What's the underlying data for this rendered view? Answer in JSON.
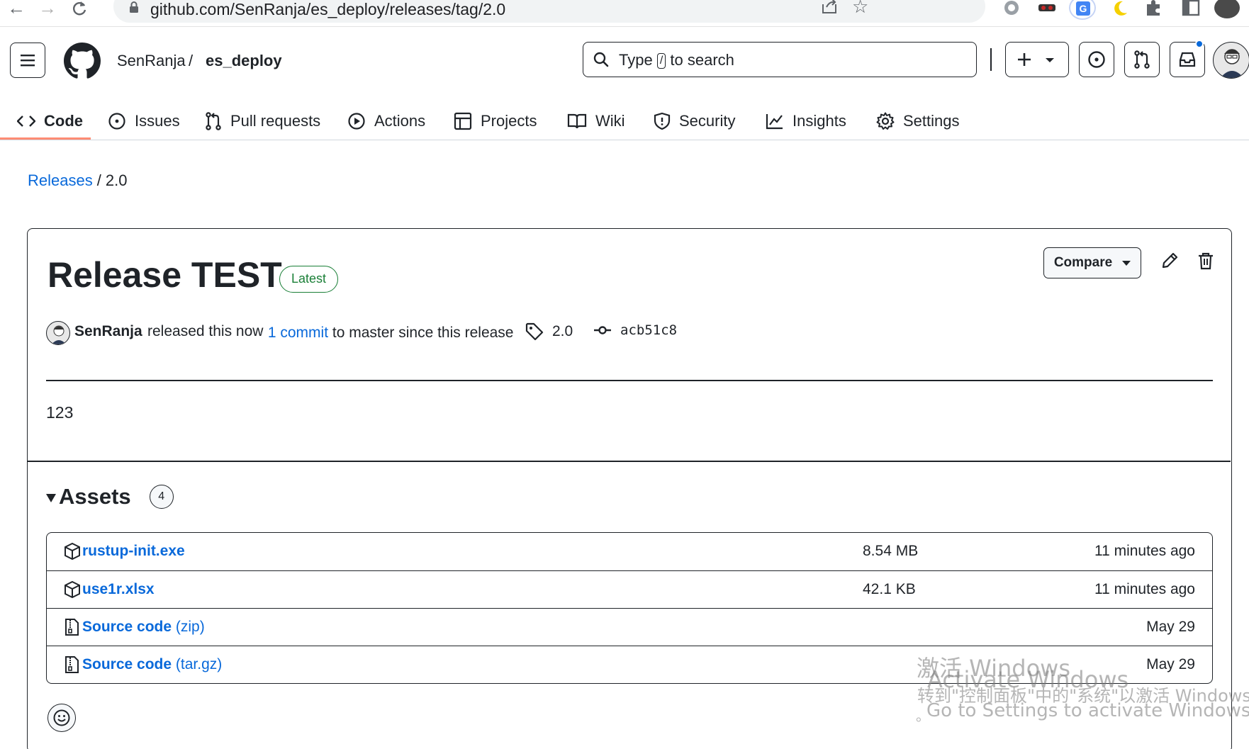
{
  "browser": {
    "url": "github.com/SenRanja/es_deploy/releases/tag/2.0"
  },
  "header": {
    "owner": "SenRanja",
    "separator": "/",
    "repo": "es_deploy",
    "search": {
      "prefix": "Type",
      "key": "/",
      "suffix": "to search"
    }
  },
  "tabs": [
    {
      "label": "Code",
      "icon": "code-icon",
      "active": true
    },
    {
      "label": "Issues",
      "icon": "issue-opened-icon"
    },
    {
      "label": "Pull requests",
      "icon": "git-pull-request-icon"
    },
    {
      "label": "Actions",
      "icon": "play-icon"
    },
    {
      "label": "Projects",
      "icon": "table-icon"
    },
    {
      "label": "Wiki",
      "icon": "book-icon"
    },
    {
      "label": "Security",
      "icon": "shield-icon"
    },
    {
      "label": "Insights",
      "icon": "graph-icon"
    },
    {
      "label": "Settings",
      "icon": "gear-icon"
    }
  ],
  "breadcrumb": {
    "link": "Releases",
    "separator": "/",
    "current": "2.0"
  },
  "release": {
    "title": "Release TEST",
    "badge": "Latest",
    "compare_label": "Compare",
    "author": "SenRanja",
    "released_text": "released this now",
    "commit_prefix": "·",
    "commit_link": "1 commit",
    "commit_suffix": "to master since this release",
    "tag": "2.0",
    "sha": "acb51c8",
    "body": "123"
  },
  "assets": {
    "title": "Assets",
    "count": "4",
    "items": [
      {
        "name": "rustup-init.exe",
        "extra": "",
        "size": "8.54 MB",
        "date": "11 minutes ago",
        "icon": "package-icon"
      },
      {
        "name": "use1r.xlsx",
        "extra": "",
        "size": "42.1 KB",
        "date": "11 minutes ago",
        "icon": "package-icon"
      },
      {
        "name": "Source code",
        "extra": "(zip)",
        "size": "",
        "date": "May 29",
        "icon": "file-zip-icon"
      },
      {
        "name": "Source code",
        "extra": "(tar.gz)",
        "size": "",
        "date": "May 29",
        "icon": "file-zip-icon"
      }
    ]
  },
  "watermark": {
    "line1_cn": "激活 Windows",
    "line1_en": "Activate Windows",
    "line2_cn": "转到\"控制面板\"中的\"系统\"以激活 Windows",
    "line2_en": "Go to Settings to activate Windows.",
    "dot": "。"
  },
  "colors": {
    "link": "#0969da",
    "latest": "#1a7f37",
    "tab_underline": "#fd8c73"
  }
}
